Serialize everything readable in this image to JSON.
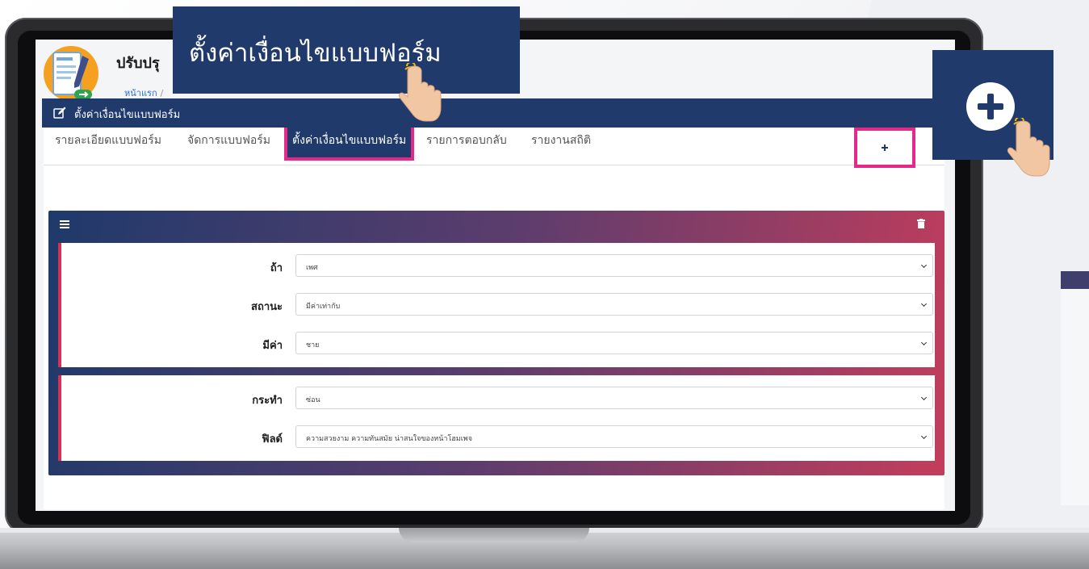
{
  "header": {
    "title": "ปรับปรุ",
    "breadcrumb": [
      "หน้าแรก",
      "/"
    ]
  },
  "tabs": [
    {
      "label": "รายละเอียดแบบฟอร์ม",
      "active": false
    },
    {
      "label": "จัดการแบบฟอร์ม",
      "active": false
    },
    {
      "label": "ตั้งค่าเงื่อนไขแบบฟอร์ม",
      "active": true
    },
    {
      "label": "รายการตอบกลับ",
      "active": false
    },
    {
      "label": "รายงานสถิติ",
      "active": false
    }
  ],
  "section": {
    "title": "ตั้งค่าเงื่อนไขแบบฟอร์ม",
    "add_icon": "plus-circle-icon",
    "edit_icon": "edit-icon"
  },
  "condition": {
    "menu_icon": "hamburger-icon",
    "delete_icon": "trash-icon",
    "if_rows": [
      {
        "label": "ถ้า",
        "value": "เพศ"
      },
      {
        "label": "สถานะ",
        "value": "มีค่าเท่ากับ"
      },
      {
        "label": "มีค่า",
        "value": "ชาย"
      }
    ],
    "action_rows": [
      {
        "label": "กระทำ",
        "value": "ซ่อน"
      },
      {
        "label": "ฟิลด์",
        "value": "ความสวยงาม ความทันสมัย น่าสนใจของหน้าโฮมเพจ"
      }
    ]
  },
  "callouts": {
    "title_text": "ตั้งค่าเงื่อนไขแบบฟอร์ม"
  },
  "colors": {
    "navy": "#1f3a6b",
    "highlight": "#e5298a",
    "gradient_end": "#c33d5c"
  }
}
